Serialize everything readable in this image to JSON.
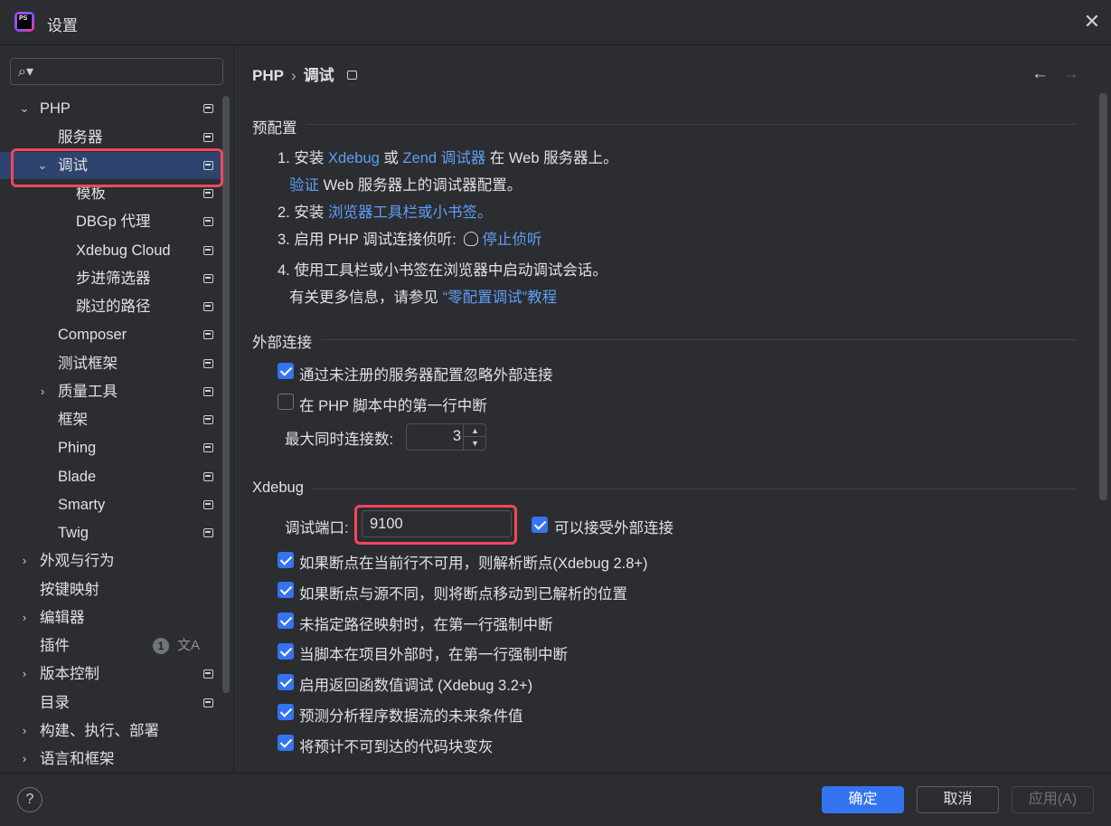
{
  "window": {
    "title": "设置",
    "logo_text": "PS",
    "close_glyph": "✕"
  },
  "search": {
    "icon": "⌕▾",
    "placeholder": ""
  },
  "sidebar": {
    "items": [
      {
        "label": "PHP",
        "arrow": "⌄"
      },
      {
        "label": "服务器"
      },
      {
        "label": "调试",
        "arrow": "⌄"
      },
      {
        "label": "模板"
      },
      {
        "label": "DBGp 代理"
      },
      {
        "label": "Xdebug Cloud"
      },
      {
        "label": "步进筛选器"
      },
      {
        "label": "跳过的路径"
      },
      {
        "label": "Composer"
      },
      {
        "label": "测试框架"
      },
      {
        "label": "质量工具",
        "arrow": "›"
      },
      {
        "label": "框架"
      },
      {
        "label": "Phing"
      },
      {
        "label": "Blade"
      },
      {
        "label": "Smarty"
      },
      {
        "label": "Twig"
      },
      {
        "label": "外观与行为",
        "arrow": "›"
      },
      {
        "label": "按键映射"
      },
      {
        "label": "编辑器",
        "arrow": "›"
      },
      {
        "label": "插件",
        "badge": "1",
        "extra_icon": "文A"
      },
      {
        "label": "版本控制",
        "arrow": "›"
      },
      {
        "label": "目录"
      },
      {
        "label": "构建、执行、部署",
        "arrow": "›"
      },
      {
        "label": "语言和框架",
        "arrow": "›"
      }
    ]
  },
  "breadcrumb": {
    "root": "PHP",
    "sep": "›",
    "current": "调试",
    "back": "←",
    "forward": "→"
  },
  "preconfig": {
    "title": "预配置",
    "step1_prefix": "1. 安装 ",
    "step1_link1": "Xdebug",
    "step1_or": " 或 ",
    "step1_link2": "Zend 调试器",
    "step1_suffix": " 在 Web 服务器上。",
    "step1b_link": "验证",
    "step1b_text": " Web 服务器上的调试器配置。",
    "step2_prefix": "2. 安装 ",
    "step2_link": "浏览器工具栏或小书签。",
    "step3_prefix": "3. 启用 PHP 调试连接侦听: ",
    "step3_link": "停止侦听",
    "step4": "4. 使用工具栏或小书签在浏览器中启动调试会话。",
    "more_prefix": "有关更多信息，请参见 ",
    "more_link": "“零配置调试”教程"
  },
  "external": {
    "title": "外部连接",
    "opt1": {
      "label": "通过未注册的服务器配置忽略外部连接",
      "checked": true
    },
    "opt2": {
      "label": "在 PHP 脚本中的第一行中断",
      "checked": false
    },
    "max_label": "最大同时连接数:",
    "max_value": "3",
    "spin_up": "▲",
    "spin_down": "▼"
  },
  "xdebug": {
    "title": "Xdebug",
    "port_label": "调试端口:",
    "port_value": "9100",
    "accept_label": "可以接受外部连接",
    "options": [
      "如果断点在当前行不可用，则解析断点(Xdebug 2.8+)",
      "如果断点与源不同，则将断点移动到已解析的位置",
      "未指定路径映射时，在第一行强制中断",
      "当脚本在项目外部时，在第一行强制中断",
      "启用返回函数值调试 (Xdebug 3.2+)",
      "预测分析程序数据流的未来条件值",
      "将预计不可到达的代码块变灰"
    ]
  },
  "footer": {
    "help": "?",
    "ok": "确定",
    "cancel": "取消",
    "apply": "应用(A)"
  },
  "colors": {
    "accent": "#3574f0",
    "link": "#5f9df7",
    "highlight": "#f0475e",
    "selection": "#2e436e"
  }
}
